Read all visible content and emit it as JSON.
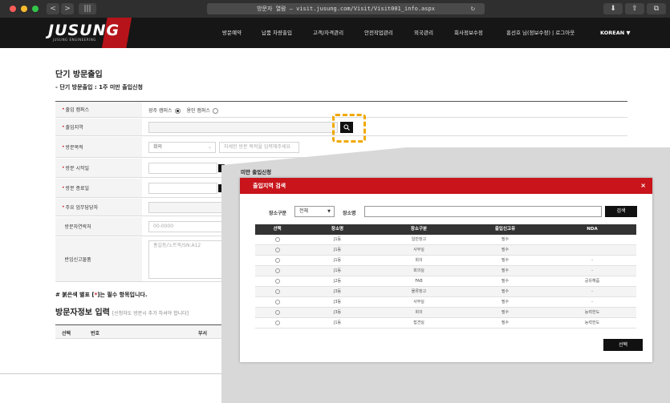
{
  "browser": {
    "back": "<",
    "forward": ">",
    "sidebar": "|||",
    "url": "방문자 열람 — visit.jusung.com/Visit/Visit001_info.aspx",
    "reload": "↻",
    "right_buttons": [
      "⬇",
      "⇧",
      "⧉"
    ]
  },
  "site": {
    "logo": "JUSUNG",
    "logo_sub": "JUSUNG ENGINEERING",
    "nav": [
      "방문예약",
      "납품 차량출입",
      "고객/자격관리",
      "안전작업관리",
      "외국관리",
      "회사정보수정",
      "홍선호 님(정보수정) | 로그아웃"
    ],
    "language": "KOREAN  ▼"
  },
  "page": {
    "title": "단기 방문출입",
    "subtitle": "- 단기 방문출입 : 1주 미만 출입신청",
    "fields": {
      "campus_label": "출입 캠퍼스",
      "campus_opt1": "광주 캠퍼스",
      "campus_opt2": "용인 캠퍼스",
      "area_label": "출입지역",
      "purpose_label": "방문목적",
      "purpose_select": "회의",
      "purpose_placeholder": "자세한 방문 목적을 입력해주세요",
      "start_label": "방문 시작일",
      "end_label": "방문 종료일",
      "manager_label": "주요 업무담당자",
      "phone_label": "방문자연락처",
      "phone_placeholder": "00-0000",
      "items_label": "반입신고물품",
      "items_placeholder": "홍길동/노트북/SN:A12"
    },
    "partial_label": "미만 출입신청",
    "note_prefix": "# 붉은색 별표 [",
    "note_star": "*",
    "note_suffix": "]는 필수 항목입니다.",
    "section2_title": "방문자정보 입력",
    "section2_hint": "[신청자도 방문시 추가 하셔야 합니다]",
    "list_headers": [
      "선택",
      "번호",
      "부서"
    ]
  },
  "modal": {
    "title": "출입지역 검색",
    "close": "×",
    "search": {
      "type_label": "장소구분",
      "type_value": "전체",
      "name_label": "장소명",
      "button": "검색"
    },
    "columns": [
      "선택",
      "장소명",
      "장소구분",
      "출입신고유",
      "NDA"
    ],
    "rows": [
      {
        "place": "J1동",
        "type": "일반창고",
        "req": "필수",
        "nda": ""
      },
      {
        "place": "J1동",
        "type": "사무실",
        "req": "필수",
        "nda": ""
      },
      {
        "place": "J1동",
        "type": "회의",
        "req": "필수",
        "nda": "-"
      },
      {
        "place": "J1동",
        "type": "회의실",
        "req": "필수",
        "nda": "-"
      },
      {
        "place": "J2동",
        "type": "FAB",
        "req": "필수",
        "nda": "공유해줌"
      },
      {
        "place": "J3동",
        "type": "물류창고",
        "req": "필수",
        "nda": "-"
      },
      {
        "place": "J3동",
        "type": "사무실",
        "req": "필수",
        "nda": "-"
      },
      {
        "place": "J3동",
        "type": "회의",
        "req": "필수",
        "nda": "능력한도"
      },
      {
        "place": "J1동",
        "type": "접견실",
        "req": "필수",
        "nda": "능력한도"
      }
    ],
    "select_button": "선택"
  },
  "colors": {
    "brand_red": "#c8141a",
    "highlight": "#f0a800"
  }
}
